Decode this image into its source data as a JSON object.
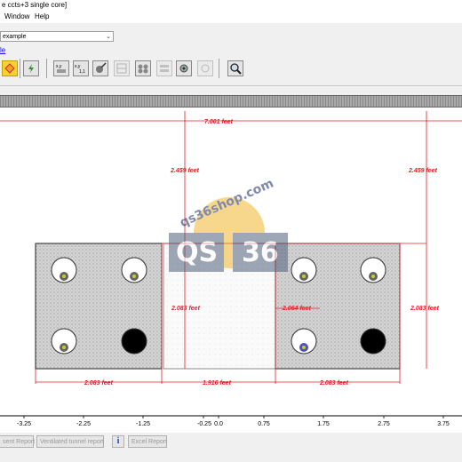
{
  "window": {
    "title": "e ccts+3 single core]"
  },
  "menu": {
    "items": [
      "Window",
      "Help"
    ]
  },
  "toolbar": {
    "config_select": "example",
    "link_label": "le"
  },
  "dimensions": {
    "top_span": "7.001 feet",
    "left_height": "2.459 feet",
    "right_height": "2.459 feet",
    "gap_height": "2.083 feet",
    "inner_height": "2.064 feet",
    "far_right_height": "2.083 feet",
    "left_block_width": "2.083 feet",
    "gap_width": "1.916 feet",
    "right_block_width": "2.083 feet"
  },
  "axis": {
    "ticks": [
      "-3.25",
      "-2.25",
      "-1.25",
      "-0.25",
      "0.0",
      "0.75",
      "1.75",
      "2.75",
      "3.75"
    ]
  },
  "bottom": {
    "buttons": [
      "sent Report",
      "Ventilated tunnel report",
      "Excel Report"
    ],
    "info": "i"
  },
  "watermark": {
    "site": "qs36shop.com",
    "left": "QS",
    "right": "36"
  },
  "colors": {
    "dimension": "#e0202a",
    "concrete": "#d8d8d8",
    "cable_core": "#c8d020"
  }
}
